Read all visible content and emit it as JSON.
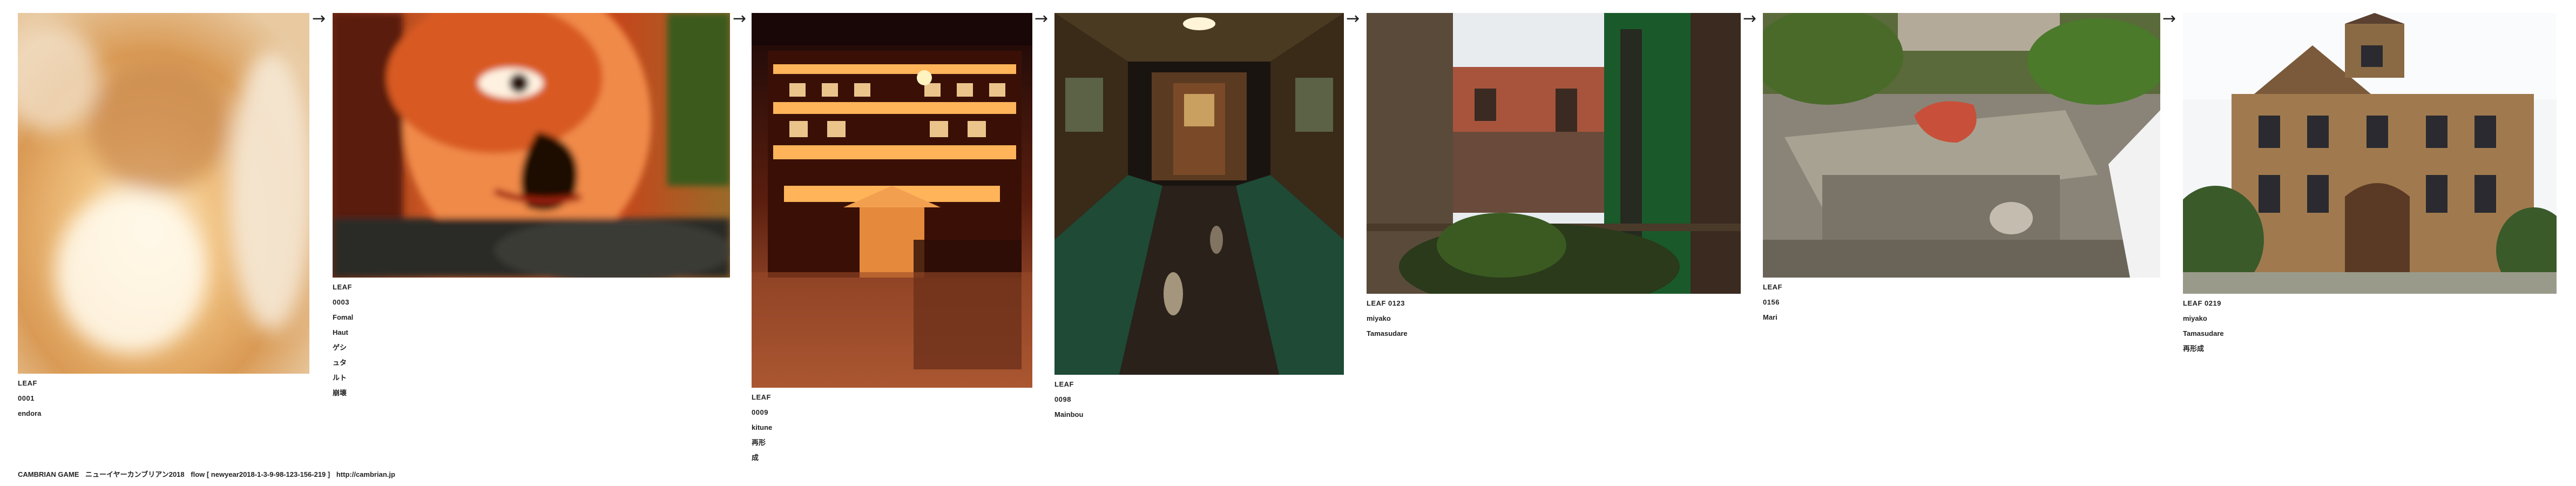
{
  "leaves": [
    {
      "id": "LEAF 0001",
      "lines": [
        "endora"
      ],
      "photo": "blurred-hand-photo"
    },
    {
      "id": "LEAF 0003",
      "lines": [
        "Fomal Haut",
        "ゲシュタルト崩壊"
      ],
      "photo": "distorted-face-photo"
    },
    {
      "id": "LEAF 0009",
      "lines": [
        "kitune",
        "再形成"
      ],
      "photo": "lit-inn-night-photo"
    },
    {
      "id": "LEAF 0098",
      "lines": [
        "Mainbou"
      ],
      "photo": "tram-interior-photo"
    },
    {
      "id": "LEAF 0123",
      "lines": [
        "miyako Tamasudare"
      ],
      "photo": "abandoned-building-photo"
    },
    {
      "id": "LEAF 0156",
      "lines": [
        "Mari"
      ],
      "photo": "ruined-structure-photo"
    },
    {
      "id": "LEAF 0219",
      "lines": [
        "miyako Tamasudare",
        "再形成"
      ],
      "photo": "victorian-mansion-photo"
    }
  ],
  "arrow_glyph": "→",
  "footer": {
    "brand": "CAMBRIAN GAME",
    "title": "ニューイヤーカンブリアン2018",
    "flow": "flow [ newyear2018-1-3-9-98-123-156-219 ]",
    "url": "http://cambrian.jp"
  }
}
